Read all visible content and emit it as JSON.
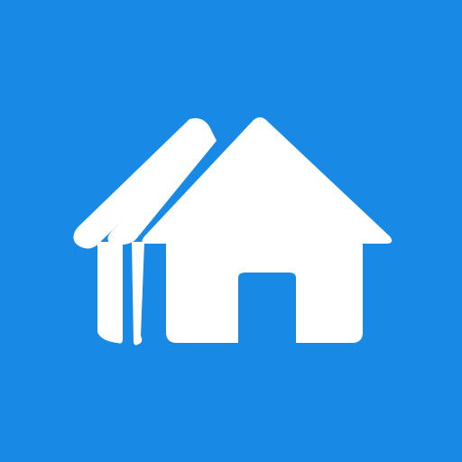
{
  "app_icon": {
    "icon": "houses-icon",
    "background_color": "#188ae6",
    "foreground_color": "#ffffff"
  }
}
